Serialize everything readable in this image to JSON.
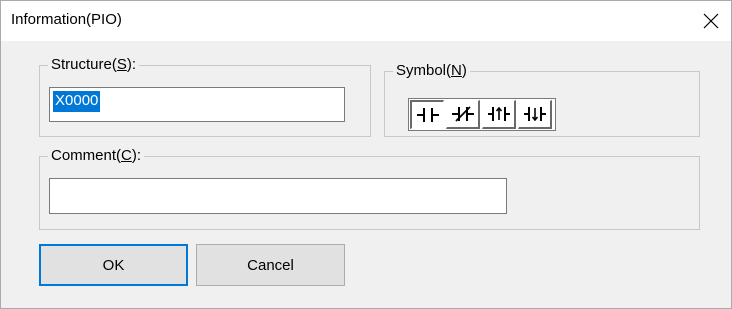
{
  "window": {
    "title": "Information(PIO)"
  },
  "structure": {
    "label_pre": "Structure(",
    "label_key": "S",
    "label_post": "):",
    "value": "X0000"
  },
  "symbol": {
    "label_pre": "Symbol(",
    "label_key": "N",
    "label_post": ")",
    "options": [
      {
        "icon": "contact-no-icon",
        "selected": true
      },
      {
        "icon": "contact-nc-icon",
        "selected": false
      },
      {
        "icon": "contact-rising-edge-icon",
        "selected": false
      },
      {
        "icon": "contact-falling-edge-icon",
        "selected": false
      }
    ]
  },
  "comment": {
    "label_pre": "Comment(",
    "label_key": "C",
    "label_post": "):",
    "value": ""
  },
  "buttons": {
    "ok": "OK",
    "cancel": "Cancel"
  },
  "colors": {
    "selection": "#0078d7",
    "background": "#f0f0f0"
  }
}
